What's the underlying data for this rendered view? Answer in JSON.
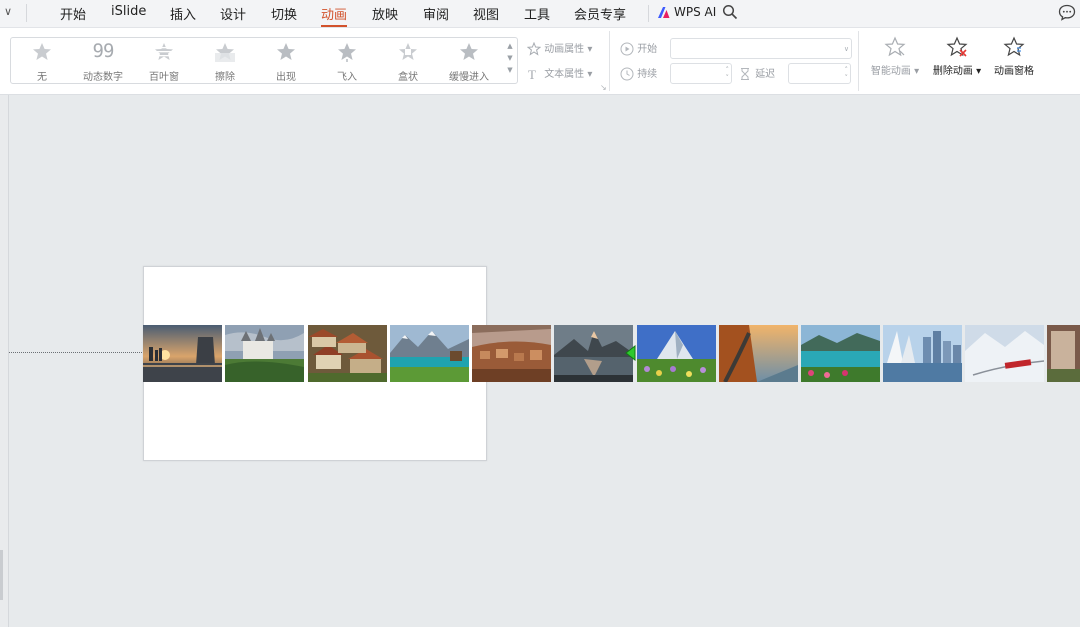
{
  "menu": {
    "tabs": [
      "开始",
      "iSlide",
      "插入",
      "设计",
      "切换",
      "动画",
      "放映",
      "审阅",
      "视图",
      "工具",
      "会员专享"
    ],
    "active_tab": "动画",
    "wps_ai": "WPS AI"
  },
  "ribbon": {
    "animations": [
      "无",
      "动态数字",
      "百叶窗",
      "擦除",
      "出现",
      "飞入",
      "盒状",
      "缓慢进入"
    ],
    "dynamic_number_glyph": "99",
    "anim_properties": "动画属性",
    "text_properties": "文本属性",
    "start_label": "开始",
    "duration_label": "持续",
    "delay_label": "延迟",
    "smart_animation": "智能动画",
    "delete_animation": "删除动画",
    "animation_pane": "动画窗格"
  },
  "colors": {
    "accent": "#d2522c",
    "anchor_green": "#2fc92f",
    "canvas": "#e7eaec"
  }
}
